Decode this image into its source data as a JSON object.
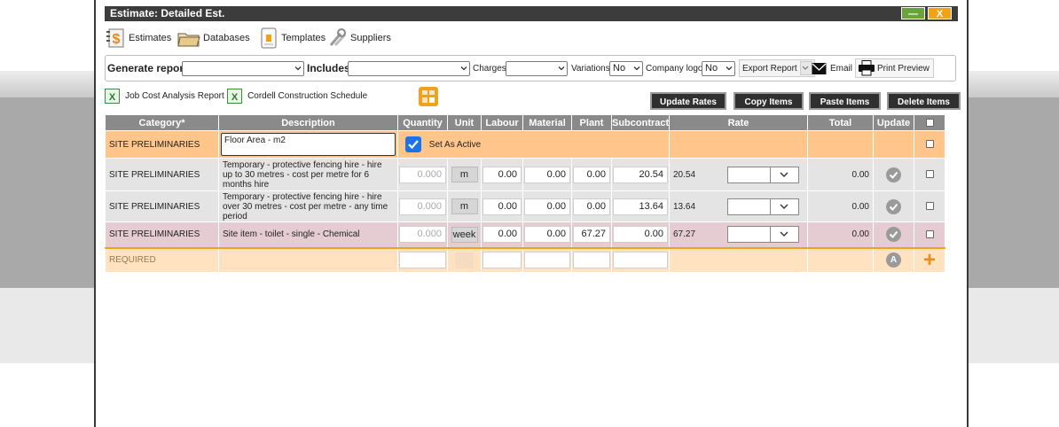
{
  "window": {
    "title": "Estimate: Detailed Est.",
    "minimize": "—",
    "close": "X"
  },
  "toolbar": {
    "estimates": "Estimates",
    "databases": "Databases",
    "templates": "Templates",
    "suppliers": "Suppliers"
  },
  "report_bar": {
    "generate_report_label": "Generate report",
    "generate_report_value": "",
    "includes_label": "Includes",
    "includes_value": "",
    "charges_label": "Charges",
    "charges_value": "",
    "variations_label": "Variations",
    "variations_value": "No",
    "company_logo_label": "Company logo",
    "company_logo_value": "No",
    "export_label": "Export Report",
    "email_label": "Email",
    "print_label": "Print Preview"
  },
  "links": {
    "job_cost": "Job Cost Analysis Report",
    "cordell": "Cordell Construction Schedule"
  },
  "actions": {
    "update_rates": "Update Rates",
    "copy_items": "Copy Items",
    "paste_items": "Paste Items",
    "delete_items": "Delete Items"
  },
  "columns": [
    "Category*",
    "Description",
    "Quantity",
    "Unit",
    "Labour",
    "Material",
    "Plant",
    "Subcontract",
    "Rate",
    "Total",
    "Update"
  ],
  "active_row": {
    "category": "SITE PRELIMINARIES",
    "description": "Floor Area - m2",
    "set_active_label": "Set As Active"
  },
  "rows": [
    {
      "category": "SITE PRELIMINARIES",
      "description": "Temporary - protective fencing hire - hire up to 30 metres - cost per metre for 6 months hire",
      "quantity": "0.000",
      "unit": "m",
      "labour": "0.00",
      "material": "0.00",
      "plant": "0.00",
      "subcontract": "20.54",
      "rate": "20.54",
      "total": "0.00"
    },
    {
      "category": "SITE PRELIMINARIES",
      "description": "Temporary - protective fencing hire - hire over 30 metres - cost per metre - any time period",
      "quantity": "0.000",
      "unit": "m",
      "labour": "0.00",
      "material": "0.00",
      "plant": "0.00",
      "subcontract": "13.64",
      "rate": "13.64",
      "total": "0.00"
    },
    {
      "category": "SITE PRELIMINARIES",
      "description": "Site item - toilet - single - Chemical",
      "quantity": "0.000",
      "unit": "week",
      "labour": "0.00",
      "material": "0.00",
      "plant": "67.27",
      "subcontract": "0.00",
      "rate": "67.27",
      "total": "0.00"
    }
  ],
  "required_row": {
    "label": "REQUIRED",
    "badge": "A",
    "add": "+"
  },
  "colors": {
    "active_row": "#ffc58a",
    "pink_row": "#e5ccd3",
    "grey_row": "#e4e4e4",
    "header": "#8a8a8a",
    "accent_orange": "#f0a21b",
    "checkbox_blue": "#1a73e8"
  }
}
